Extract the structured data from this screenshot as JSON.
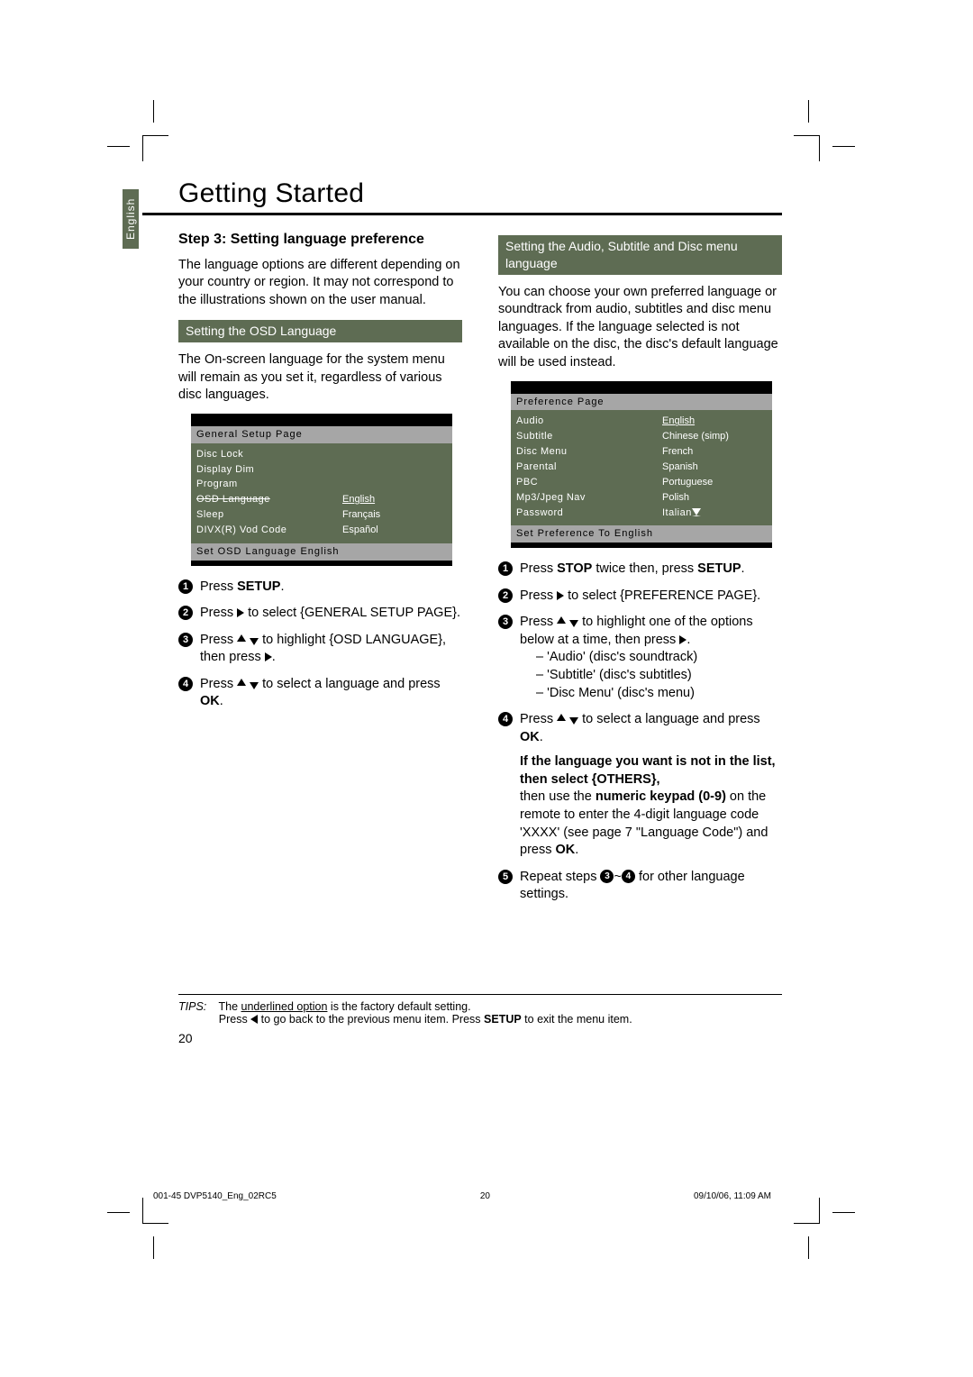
{
  "title": "Getting Started",
  "language_tab": "English",
  "left": {
    "step_title": "Step 3: Setting language preference",
    "intro": "The language options are different depending on your country or region. It may not correspond to the illustrations shown on the user manual.",
    "subhead": "Setting the OSD Language",
    "osd_para": "The On-screen language for the system menu will remain as you set it, regardless of various disc languages.",
    "osd": {
      "head": "General Setup Page",
      "rows": [
        {
          "l": "Disc Lock",
          "r": ""
        },
        {
          "l": "Display Dim",
          "r": ""
        },
        {
          "l": "Program",
          "r": ""
        },
        {
          "l": "OSD Language",
          "r": "English",
          "strike": true,
          "underline_r": true
        },
        {
          "l": "Sleep",
          "r": "Français"
        },
        {
          "l": "DIVX(R) Vod Code",
          "r": "Español"
        }
      ],
      "foot": "Set OSD Language English"
    },
    "steps": {
      "s1_a": "Press ",
      "s1_b": "SETUP",
      "s1_c": ".",
      "s2_a": "Press ",
      "s2_b": " to select {GENERAL SETUP PAGE}.",
      "s3_a": "Press ",
      "s3_b": " to highlight {OSD LANGUAGE}, then press ",
      "s3_c": ".",
      "s4_a": "Press ",
      "s4_b": " to select a language and press ",
      "s4_c": "OK",
      "s4_d": "."
    }
  },
  "right": {
    "subhead": "Setting the Audio, Subtitle and Disc menu language",
    "intro": "You can choose your own preferred language or soundtrack from audio, subtitles and disc menu languages. If the language selected is not available on the disc, the disc's default language will be used instead.",
    "osd": {
      "head": "Preference Page",
      "rows": [
        {
          "l": "Audio",
          "r": "English",
          "underline_r": true
        },
        {
          "l": "Subtitle",
          "r": "Chinese (simp)"
        },
        {
          "l": "Disc Menu",
          "r": "French"
        },
        {
          "l": "Parental",
          "r": "Spanish"
        },
        {
          "l": "PBC",
          "r": "Portuguese"
        },
        {
          "l": "Mp3/Jpeg Nav",
          "r": "Polish"
        },
        {
          "l": "Password",
          "r": "Italian"
        }
      ],
      "foot": "Set Preference To English"
    },
    "steps": {
      "s1_a": "Press ",
      "s1_b": "STOP",
      "s1_c": " twice then, press ",
      "s1_d": "SETUP",
      "s1_e": ".",
      "s2_a": "Press ",
      "s2_b": " to select {PREFERENCE PAGE}.",
      "s3_a": "Press ",
      "s3_b": " to highlight one of the options below at a time, then press ",
      "s3_c": ".",
      "s3_items": [
        "'Audio' (disc's soundtrack)",
        "'Subtitle' (disc's subtitles)",
        "'Disc Menu' (disc's menu)"
      ],
      "s4_a": "Press ",
      "s4_b": " to select a language and press ",
      "s4_c": "OK",
      "s4_d": ".",
      "s4_bold": "If the language you want is not in the list, then select {OTHERS},",
      "s4_tail_a": "then use the ",
      "s4_tail_b": "numeric keypad (0-9)",
      "s4_tail_c": " on the remote to enter the 4-digit language code 'XXXX' (see page 7 \"Language Code\") and press ",
      "s4_tail_d": "OK",
      "s4_tail_e": ".",
      "s5_a": "Repeat steps ",
      "s5_b": "~",
      "s5_c": " for other language settings."
    }
  },
  "tips": {
    "label": "TIPS:",
    "line1_a": "The ",
    "line1_b": "underlined option",
    "line1_c": " is the factory default setting.",
    "line2_a": "Press ",
    "line2_b": " to go back to the previous menu item. Press ",
    "line2_c": "SETUP",
    "line2_d": " to exit the menu item."
  },
  "page_number": "20",
  "footer": {
    "left": "001-45 DVP5140_Eng_02RC5",
    "mid": "20",
    "right": "09/10/06, 11:09 AM"
  }
}
